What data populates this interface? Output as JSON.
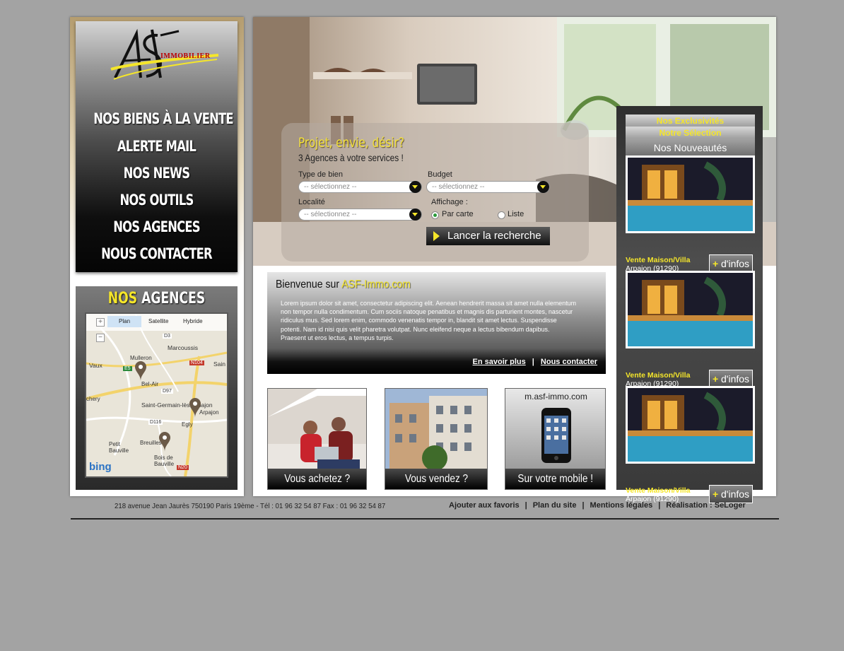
{
  "logo": {
    "text": "IMMOBILIER"
  },
  "nav": [
    {
      "label": "NOS BIENS À LA VENTE"
    },
    {
      "label": "ALERTE MAIL"
    },
    {
      "label": "NOS NEWS"
    },
    {
      "label": "NOS OUTILS"
    },
    {
      "label": "NOS AGENCES"
    },
    {
      "label": "NOUS CONTACTER"
    }
  ],
  "agencies": {
    "title_hl": "NOS",
    "title": "AGENCES",
    "map": {
      "tabs": [
        "Plan",
        "Satellite",
        "Hybride"
      ],
      "places": [
        "Marcoussis",
        "Mulleron",
        "Vaux",
        "Bel-Air",
        "Saint-Germain-lès-Arpajon",
        "Arpajon",
        "Egly",
        "Breuilles",
        "Petit Bauville",
        "Bois de Bauville",
        "chery",
        "Sain"
      ],
      "roads": [
        "D3",
        "E5",
        "N104",
        "D97",
        "D116",
        "N20"
      ],
      "brand": "bing"
    }
  },
  "hero": {
    "title": "Projet, envie, désir?",
    "subtitle": "3 Agences à votre services !",
    "type_label": "Type de bien",
    "type_value": "-- sélectionnez --",
    "budget_label": "Budget",
    "budget_value": "-- sélectionnez --",
    "locality_label": "Localité",
    "locality_value": "-- sélectionnez --",
    "display_label": "Affichage :",
    "radio_map": "Par carte",
    "radio_list": "Liste",
    "display_selected": "Par carte",
    "search_button": "Lancer la recherche"
  },
  "welcome": {
    "title": "Bienvenue sur",
    "title_hl": "ASF-Immo.com",
    "text": "Lorem ipsum dolor sit amet, consectetur adipiscing elit. Aenean hendrerit massa sit amet nulla elementum non tempor nulla condimentum. Cum sociis natoque penatibus et magnis dis parturient montes, nascetur ridiculus mus. Sed lorem enim, commodo venenatis tempor in, blandit sit amet lectus. Suspendisse potenti. Nam id nisi quis velit pharetra volutpat. Nunc eleifend neque a lectus bibendum dapibus. Praesent ut eros lectus, a tempus turpis.",
    "link_more": "En savoir plus",
    "link_contact": "Nous contacter"
  },
  "tiles": [
    {
      "caption": "Vous achetez ?"
    },
    {
      "caption": "Vous vendez ?"
    },
    {
      "caption": "Sur votre mobile !",
      "header": "m.asf-immo.com"
    }
  ],
  "rail": {
    "tabs": [
      "Nos Exclusivités",
      "Notre Sélection",
      "Nos Nouveautés"
    ],
    "active_tab": "Nos Nouveautés",
    "listings": [
      {
        "title": "Vente Maison/Villa",
        "city": "Arpajon (91290)",
        "button_plus": "+",
        "button": "d'infos"
      },
      {
        "title": "Vente Maison/Villa",
        "city": "Arpajon (91290)",
        "button_plus": "+",
        "button": "d'infos"
      },
      {
        "title": "Vente Maison/Villa",
        "city": "Arpajon (91290)",
        "button_plus": "+",
        "button": "d'infos"
      }
    ]
  },
  "footer": {
    "address": "218 avenue Jean Jaurès 750190 Paris 19ème -  Tél : 01 96 32 54 87  Fax : 01 96 32 54 87",
    "links": [
      "Ajouter aux favoris",
      "Plan du site",
      "Mentions légales",
      "Réalisation : SeLoger"
    ]
  },
  "colors": {
    "accent": "#f5e62a",
    "background": "#a3a3a3",
    "panel_dark": "#111111"
  }
}
